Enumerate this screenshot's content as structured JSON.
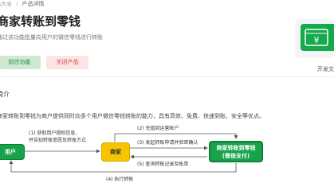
{
  "breadcrumb": {
    "parent": "品大全",
    "separator": "/",
    "current": "产品详情"
  },
  "header": {
    "title": "商家转账到零钱",
    "subtitle": "通过该功能批量向用户的微信零钱进行转账",
    "primary_button": "前往功能",
    "secondary_button": "关闭产品",
    "logo_glyph": "¥",
    "developer_label": "开发文"
  },
  "intro": {
    "section_title": "简介",
    "description": "商家转账到零钱为商户提供同时向多个用户微信零钱转账的能力，具有高效、免费、快速到账、安全等优点。"
  },
  "diagram": {
    "nodes": {
      "user": "用户",
      "merchant": "商家",
      "product_line1": "商家转账到零钱",
      "product_line2": "(微信支付)"
    },
    "labels": {
      "step1_line1": "(1) 获取用户授权信息,",
      "step1_line2": "并告知转账意愿及转账方式",
      "step2": "(2) 充值到运营帐户",
      "step3": "(3) 发起转账申请并验密确认",
      "step5": "(5) 查询转账记录及账单",
      "step4": "(4) 执行转账"
    }
  },
  "colors": {
    "brand_green": "#16a34a",
    "merchant_yellow": "#f7c400",
    "danger": "#e04848"
  }
}
